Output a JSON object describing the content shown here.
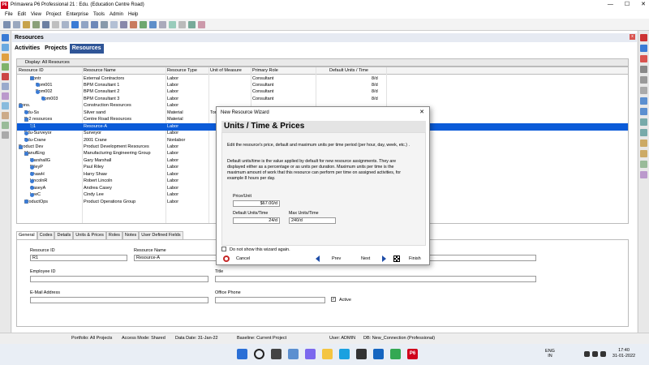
{
  "window": {
    "app_logo": "P6",
    "title": "Primavera P6 Professional 21 : Edu. (Education Centre Road)",
    "minimize": "—",
    "maximize": "☐",
    "close": "✕"
  },
  "menu": [
    "File",
    "Edit",
    "View",
    "Project",
    "Enterprise",
    "Tools",
    "Admin",
    "Help"
  ],
  "panel": {
    "title": "Resources",
    "close": "x",
    "tabs": [
      "Activities",
      "Projects",
      "Resources"
    ],
    "active_tab": "Resources"
  },
  "filter_bar": {
    "text": "Display: All Resources"
  },
  "grid": {
    "columns": [
      "Resource ID",
      "Resource Name",
      "Resource Type",
      "Unit of Measure",
      "Primary Role",
      "Default Units / Time"
    ],
    "rows": [
      {
        "id": "Contr",
        "name": "External Contractors",
        "type": "Labor",
        "uom": "",
        "role": "Consultant",
        "units": "8/d",
        "indent": 2,
        "expander": "−",
        "selected": false
      },
      {
        "id": "Bpm001",
        "name": "BPM Consultant 1",
        "type": "Labor",
        "uom": "",
        "role": "Consultant",
        "units": "8/d",
        "indent": 3,
        "expander": "",
        "selected": false
      },
      {
        "id": "Bpm002",
        "name": "BPM Consultant 2",
        "type": "Labor",
        "uom": "",
        "role": "Consultant",
        "units": "8/d",
        "indent": 3,
        "expander": "",
        "selected": false
      },
      {
        "id": "Bpm003",
        "name": "BPM Consultant 3",
        "type": "Labor",
        "uom": "",
        "role": "Consultant",
        "units": "8/d",
        "indent": 4,
        "expander": "",
        "selected": false
      },
      {
        "id": "Cons.",
        "name": "Construction Resources",
        "type": "Labor",
        "uom": "",
        "role": "",
        "units": "",
        "indent": 0,
        "expander": "−",
        "selected": false
      },
      {
        "id": "Edu-Ss",
        "name": "Silver sand",
        "type": "Material",
        "uom": "Tons",
        "role": "",
        "units": "",
        "indent": 1,
        "expander": "",
        "selected": false
      },
      {
        "id": "Pr2 resources",
        "name": "Centre Road Resources",
        "type": "Material",
        "uom": "",
        "role": "",
        "units": "",
        "indent": 1,
        "expander": "−",
        "selected": false
      },
      {
        "id": "R1",
        "name": "Resource-A",
        "type": "Labor",
        "uom": "",
        "role": "",
        "units": "",
        "indent": 2,
        "expander": "",
        "selected": true
      },
      {
        "id": "Edu-Surveyor",
        "name": "Surveyor",
        "type": "Labor",
        "uom": "",
        "role": "",
        "units": "",
        "indent": 1,
        "expander": "",
        "selected": false
      },
      {
        "id": "Edu-Crane",
        "name": "2001 Crane",
        "type": "Nonlabor",
        "uom": "",
        "role": "",
        "units": "",
        "indent": 1,
        "expander": "",
        "selected": false
      },
      {
        "id": "Product Dev",
        "name": "Product Development Resources",
        "type": "Labor",
        "uom": "",
        "role": "",
        "units": "",
        "indent": 0,
        "expander": "−",
        "selected": false
      },
      {
        "id": "ManufEng",
        "name": "Manufacturing Engineering Group",
        "type": "Labor",
        "uom": "",
        "role": "",
        "units": "",
        "indent": 1,
        "expander": "−",
        "selected": false
      },
      {
        "id": "MarshallG",
        "name": "Gary Marshall",
        "type": "Labor",
        "uom": "",
        "role": "",
        "units": "",
        "indent": 2,
        "expander": "",
        "selected": false
      },
      {
        "id": "RileyP",
        "name": "Paul Riley",
        "type": "Labor",
        "uom": "",
        "role": "",
        "units": "",
        "indent": 2,
        "expander": "",
        "selected": false
      },
      {
        "id": "ShawH",
        "name": "Harry Shaw",
        "type": "Labor",
        "uom": "",
        "role": "",
        "units": "",
        "indent": 2,
        "expander": "",
        "selected": false
      },
      {
        "id": "LincolnR",
        "name": "Robert Lincoln",
        "type": "Labor",
        "uom": "",
        "role": "",
        "units": "",
        "indent": 2,
        "expander": "",
        "selected": false
      },
      {
        "id": "CaseyA",
        "name": "Andrea Casey",
        "type": "Labor",
        "uom": "",
        "role": "",
        "units": "",
        "indent": 2,
        "expander": "",
        "selected": false
      },
      {
        "id": "LeeC",
        "name": "Cindy Lee",
        "type": "Labor",
        "uom": "",
        "role": "",
        "units": "",
        "indent": 2,
        "expander": "",
        "selected": false
      },
      {
        "id": "ProductOps",
        "name": "Product Operations Group",
        "type": "Labor",
        "uom": "",
        "role": "",
        "units": "",
        "indent": 1,
        "expander": "+",
        "selected": false
      }
    ]
  },
  "details": {
    "tabs": [
      "General",
      "Codes",
      "Details",
      "Units & Prices",
      "Roles",
      "Notes",
      "User Defined Fields"
    ],
    "active_tab": "General",
    "resource_id_label": "Resource ID",
    "resource_id_value": "R1",
    "resource_name_label": "Resource Name",
    "resource_name_value": "Resource-A",
    "employee_id_label": "Employee ID",
    "title_label": "Title",
    "email_label": "E-Mail Address",
    "office_phone_label": "Office Phone",
    "active_label": "Active",
    "active_check": "✓"
  },
  "dialog": {
    "title": "New Resource Wizard",
    "close": "✕",
    "header": "Units / Time & Prices",
    "intro": "Edit the resource's price, default and maximum units per time period (per hour, day, week, etc.) .",
    "para_line1": "Default units/time is the value applied by default for new resource assignments.  They are",
    "para_line2": "displayed either as a percentage or as units per duration. Maximum units per time is the",
    "para_line3": "maximum amount of work that this resource can perform per time on assigned activities, for",
    "para_line4": "example 8 hours per day.",
    "price_label": "Price/Unit",
    "price_value": "$67.00/d",
    "default_units_label": "Default Units/Time",
    "default_units_value": "24/d",
    "max_units_label": "Max Units/Time",
    "max_units_value": "240/d",
    "dont_show": "Do not show this wizard again.",
    "cancel": "Cancel",
    "prev": "Prev",
    "next": "Next",
    "finish": "Finish"
  },
  "status": {
    "portfolio": "Portfolio: All Projects",
    "access": "Access Mode: Shared",
    "data_date": "Data Date: 31-Jan-22",
    "baseline": "Baseline: Current Project",
    "user": "User: ADMIN",
    "db": "DB: New_Connection (Professional)"
  },
  "taskbar": {
    "lang1": "ENG",
    "lang2": "IN",
    "time": "17:40",
    "date": "31-01-2022",
    "p6_label": "P6"
  }
}
